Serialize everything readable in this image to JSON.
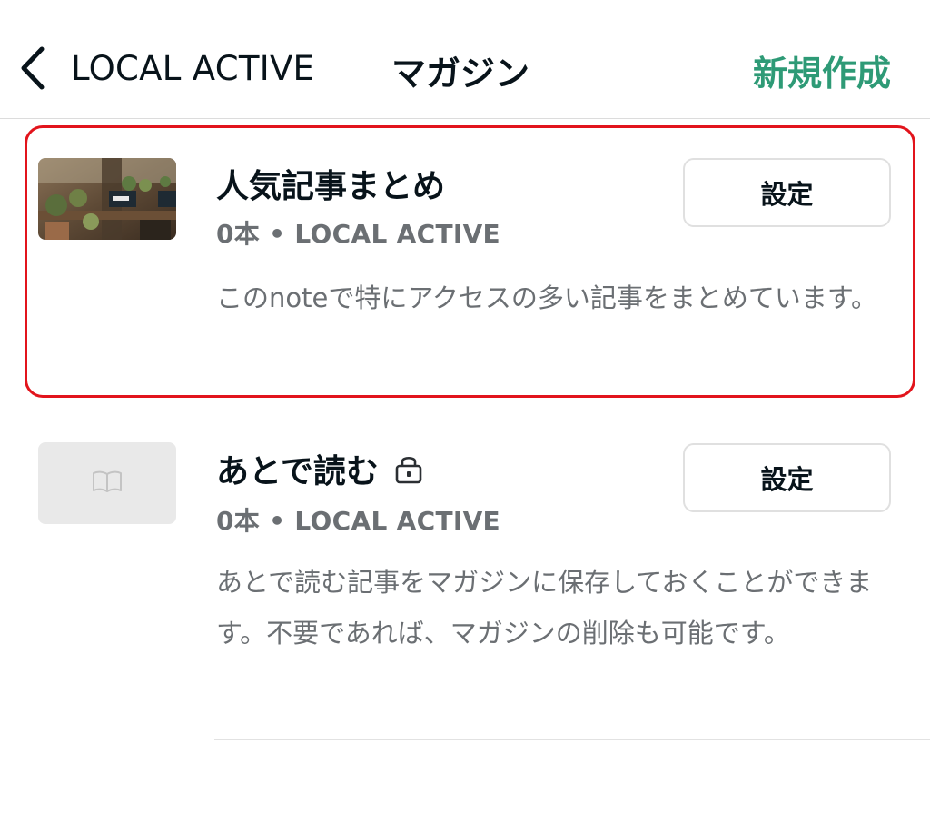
{
  "header": {
    "back_label": "LOCAL ACTIVE",
    "title": "マガジン",
    "new_label": "新規作成",
    "accent_color": "#2e9a76"
  },
  "magazines": [
    {
      "title": "人気記事まとめ",
      "meta": "0本 • LOCAL ACTIVE",
      "description": "このnoteで特にアクセスの多い記事をまとめています。",
      "settings_label": "設定",
      "thumbnail": "plants-photo",
      "highlighted": true,
      "highlight_color": "#e2141c"
    },
    {
      "title": "あとで読む",
      "meta": "0本 • LOCAL ACTIVE",
      "description": "あとで読む記事をマガジンに保存しておくことができます。不要であれば、マガジンの削除も可能です。",
      "settings_label": "設定",
      "thumbnail": "book-icon",
      "private": true,
      "lock_icon": "lock-icon"
    }
  ]
}
